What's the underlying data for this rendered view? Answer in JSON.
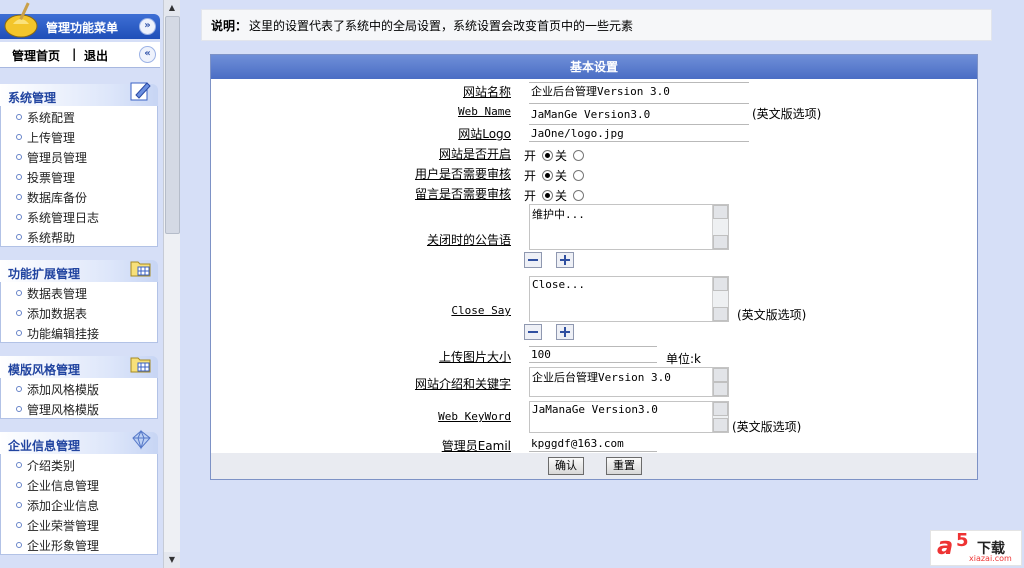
{
  "sidebar": {
    "title": "管理功能菜单",
    "home": "管理首页",
    "separator": "|",
    "logout": "退出",
    "sections": [
      {
        "title": "系统管理",
        "items": [
          "系统配置",
          "上传管理",
          "管理员管理",
          "投票管理",
          "数据库备份",
          "系统管理日志",
          "系统帮助"
        ]
      },
      {
        "title": "功能扩展管理",
        "items": [
          "数据表管理",
          "添加数据表",
          "功能编辑挂接"
        ]
      },
      {
        "title": "模版风格管理",
        "items": [
          "添加风格模版",
          "管理风格模版"
        ]
      },
      {
        "title": "企业信息管理",
        "items": [
          "介绍类别",
          "企业信息管理",
          "添加企业信息",
          "企业荣誉管理",
          "企业形象管理"
        ]
      }
    ]
  },
  "note": {
    "label": "说明：",
    "text": "这里的设置代表了系统中的全局设置，系统设置会改变首页中的一些元素"
  },
  "panel": {
    "title": "基本设置",
    "site_name_label": "网站名称",
    "site_name_value": "企业后台管理Version 3.0",
    "web_name_label": "Web Name",
    "web_name_value": "JaManGe Version3.0",
    "english_hint": "(英文版选项)",
    "logo_label": "网站Logo",
    "logo_value": "JaOne/logo.jpg",
    "site_open_label": "网站是否开启",
    "user_review_label": "用户是否需要审核",
    "msg_review_label": "留言是否需要审核",
    "opt_open": "开",
    "opt_close": "关",
    "close_notice_label": "关闭时的公告语",
    "close_notice_value": "维护中...",
    "close_say_label": "Close Say",
    "close_say_value": "Close...",
    "upload_size_label": "上传图片大小",
    "upload_size_value": "100",
    "upload_unit": "单位:k",
    "intro_label": "网站介绍和关键字",
    "intro_value": "企业后台管理Version 3.0",
    "web_keyword_label": "Web KeyWord",
    "web_keyword_value": "JaManaGe Version3.0",
    "admin_email_label": "管理员Eamil",
    "admin_email_value": "kpggdf@163.com",
    "confirm_button": "确认",
    "reset_button": "重置"
  },
  "watermark": {
    "brand_a": "a",
    "brand_5": "5",
    "brand_text": "下载",
    "url": "xiazai.com"
  }
}
